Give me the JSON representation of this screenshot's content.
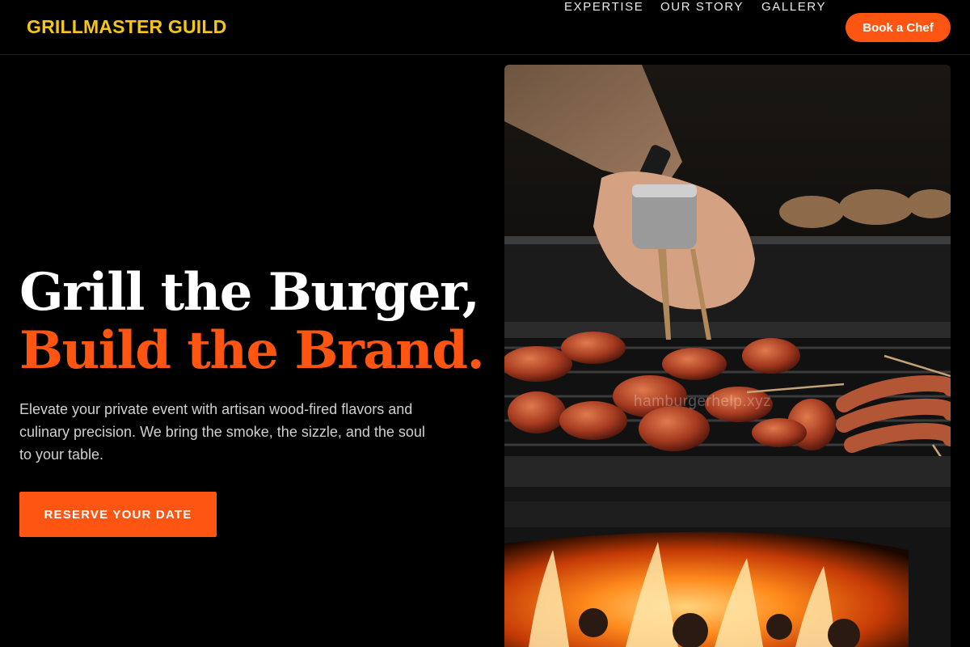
{
  "header": {
    "logo": "GRILLMASTER GUILD",
    "nav": [
      {
        "label": "EXPERTISE"
      },
      {
        "label": "OUR STORY"
      },
      {
        "label": "GALLERY"
      }
    ],
    "cta_label": "Book a Chef"
  },
  "hero": {
    "headline_line1": "Grill the Burger,",
    "headline_line2": "Build the Brand.",
    "description": "Elevate your private event with artisan wood-fired flavors and culinary precision. We bring the smoke, the sizzle, and the soul to your table.",
    "cta_label": "RESERVE YOUR DATE"
  },
  "image": {
    "watermark": "hamburgerhelp.xyz"
  },
  "colors": {
    "accent": "#ff5512",
    "logo": "#f5c518",
    "background": "#000000"
  }
}
